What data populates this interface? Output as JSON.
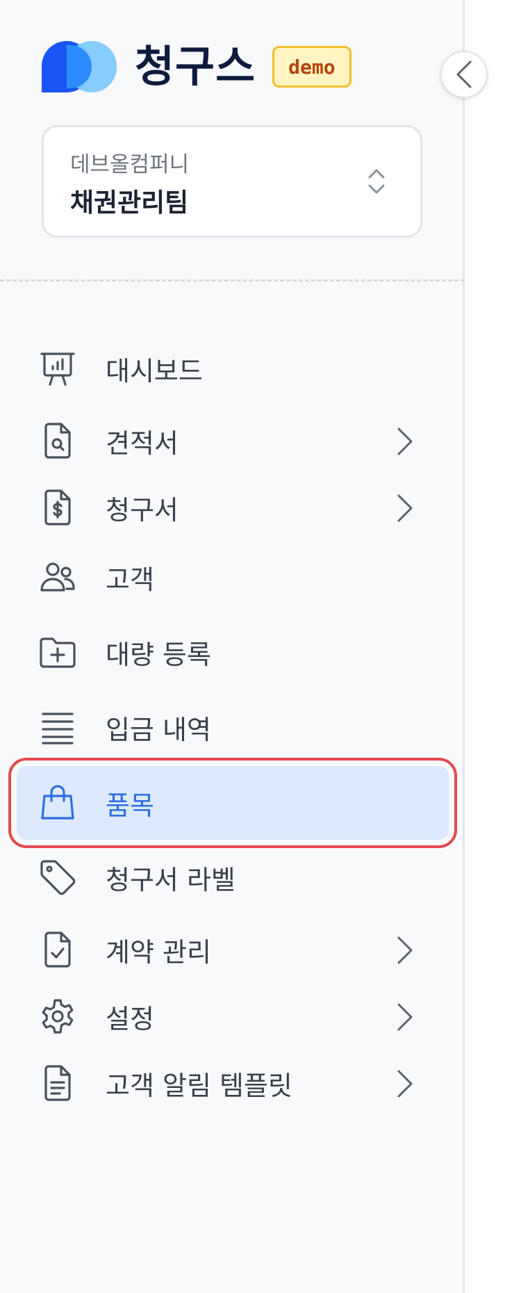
{
  "brand": {
    "name": "청구스",
    "badge": "demo"
  },
  "organization": {
    "company": "데브올컴퍼니",
    "team": "채권관리팀"
  },
  "nav": [
    {
      "label": "대시보드",
      "icon": "presentation-chart-icon",
      "has_submenu": false,
      "active": false
    },
    {
      "label": "견적서",
      "icon": "document-search-icon",
      "has_submenu": true,
      "active": false
    },
    {
      "label": "청구서",
      "icon": "document-dollar-icon",
      "has_submenu": true,
      "active": false
    },
    {
      "label": "고객",
      "icon": "users-icon",
      "has_submenu": false,
      "active": false
    },
    {
      "label": "대량 등록",
      "icon": "folder-plus-icon",
      "has_submenu": false,
      "active": false
    },
    {
      "label": "입금 내역",
      "icon": "list-lines-icon",
      "has_submenu": false,
      "active": false
    },
    {
      "label": "품목",
      "icon": "shopping-bag-icon",
      "has_submenu": false,
      "active": true
    },
    {
      "label": "청구서 라벨",
      "icon": "tag-icon",
      "has_submenu": false,
      "active": false
    },
    {
      "label": "계약 관리",
      "icon": "document-check-icon",
      "has_submenu": true,
      "active": false
    },
    {
      "label": "설정",
      "icon": "gear-icon",
      "has_submenu": true,
      "active": false
    },
    {
      "label": "고객 알림 템플릿",
      "icon": "document-text-icon",
      "has_submenu": true,
      "active": false
    }
  ],
  "colors": {
    "accent": "#2d6fe0",
    "active_bg": "#dce9fe",
    "highlight_outline": "#e34a4f",
    "brand_text": "#0f1b3d"
  }
}
